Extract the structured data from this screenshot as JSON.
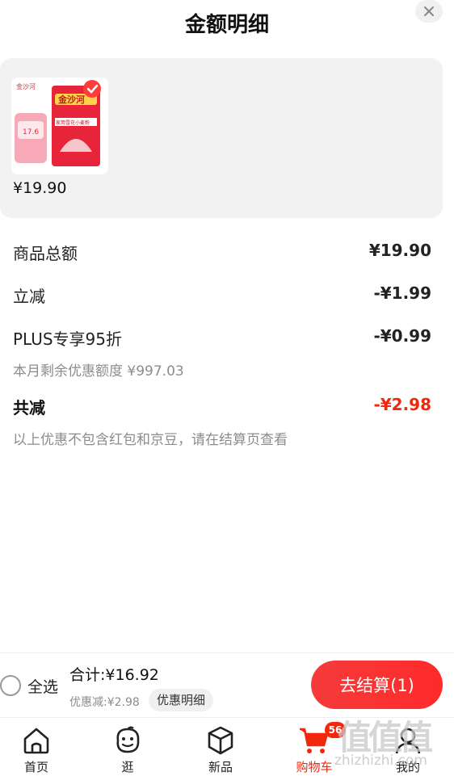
{
  "header": {
    "title": "金额明细"
  },
  "product": {
    "brand": "金沙河",
    "package_text": "家用雪花小麦粉",
    "promo_price": "17.6",
    "price": "¥19.90"
  },
  "summary": {
    "rows": [
      {
        "label": "商品总额",
        "value": "¥19.90"
      },
      {
        "label": "立减",
        "value": "-¥1.99"
      },
      {
        "label": "PLUS专享95折",
        "value": "-¥0.99",
        "note": "本月剩余优惠额度 ¥997.03"
      }
    ],
    "total": {
      "label": "共减",
      "value": "-¥2.98",
      "note": "以上优惠不包含红包和京豆，请在结算页查看"
    }
  },
  "bottom_bar": {
    "select_all_label": "全选",
    "sum_text": "合计:¥16.92",
    "discount_text": "优惠减:¥2.98",
    "detail_button": "优惠明细",
    "checkout_button": "去结算(1)"
  },
  "tabbar": {
    "items": [
      {
        "label": "首页",
        "icon": "home-icon"
      },
      {
        "label": "逛",
        "icon": "browse-face-icon"
      },
      {
        "label": "新品",
        "icon": "cube-icon"
      },
      {
        "label": "购物车",
        "icon": "cart-icon",
        "badge": "56",
        "active": true
      },
      {
        "label": "我的",
        "icon": "profile-icon"
      }
    ]
  },
  "watermark": {
    "logo": "值值值",
    "site": "zhizhizhi.com"
  },
  "colors": {
    "accent": "#f2270c",
    "card_bg": "#f2f2f2"
  }
}
